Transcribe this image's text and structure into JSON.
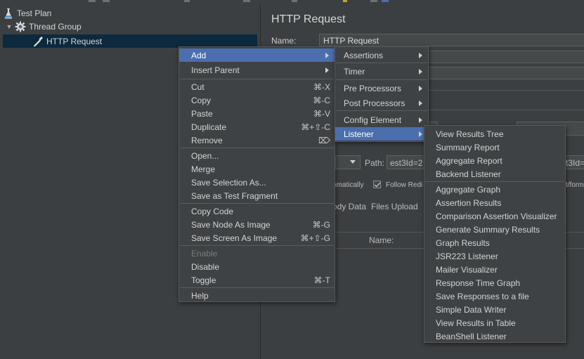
{
  "tree": {
    "items": [
      {
        "label": "Test Plan",
        "icon": "flask-icon"
      },
      {
        "label": "Thread Group",
        "icon": "gear-icon"
      },
      {
        "label": "HTTP Request",
        "icon": "pipette-icon"
      }
    ]
  },
  "editor": {
    "title": "HTTP Request",
    "name_label": "Name:",
    "name_value": "HTTP Request",
    "path_label": "Path:",
    "path_value": "est3Id=2",
    "path_right_value": "t3Id=",
    "auto_label": "omatically",
    "follow_label": "Follow Redi",
    "form_label": "t/form",
    "tab_body": "ody Data",
    "tab_files": "Files Upload",
    "table_name_header": "Name:"
  },
  "context_menu": {
    "items": [
      {
        "label": "Add",
        "shortcut": "",
        "submenu": true,
        "highlight": true
      },
      {
        "label": "Insert Parent",
        "shortcut": "",
        "submenu": true
      },
      {
        "label": "Cut",
        "shortcut": "⌘-X"
      },
      {
        "label": "Copy",
        "shortcut": "⌘-C"
      },
      {
        "label": "Paste",
        "shortcut": "⌘-V"
      },
      {
        "label": "Duplicate",
        "shortcut": "⌘+⇧-C"
      },
      {
        "label": "Remove",
        "shortcut": "⌦"
      },
      {
        "label": "Open...",
        "shortcut": ""
      },
      {
        "label": "Merge",
        "shortcut": ""
      },
      {
        "label": "Save Selection As...",
        "shortcut": ""
      },
      {
        "label": "Save as Test Fragment",
        "shortcut": ""
      },
      {
        "label": "Copy Code",
        "shortcut": ""
      },
      {
        "label": "Save Node As Image",
        "shortcut": "⌘-G"
      },
      {
        "label": "Save Screen As Image",
        "shortcut": "⌘+⇧-G"
      },
      {
        "label": "Enable",
        "shortcut": "",
        "disabled": true
      },
      {
        "label": "Disable",
        "shortcut": ""
      },
      {
        "label": "Toggle",
        "shortcut": "⌘-T"
      },
      {
        "label": "Help",
        "shortcut": ""
      }
    ]
  },
  "add_menu": {
    "items": [
      {
        "label": "Assertions"
      },
      {
        "label": "Timer"
      },
      {
        "label": "Pre Processors"
      },
      {
        "label": "Post Processors"
      },
      {
        "label": "Config Element"
      },
      {
        "label": "Listener",
        "highlight": true
      }
    ]
  },
  "listener_menu": {
    "items": [
      "View Results Tree",
      "Summary Report",
      "Aggregate Report",
      "Backend Listener",
      "Aggregate Graph",
      "Assertion Results",
      "Comparison Assertion Visualizer",
      "Generate Summary Results",
      "Graph Results",
      "JSR223 Listener",
      "Mailer Visualizer",
      "Response Time Graph",
      "Save Responses to a file",
      "Simple Data Writer",
      "View Results in Table",
      "BeanShell Listener"
    ]
  },
  "colors": {
    "background": "#3c3f41",
    "menu_background": "#3e4244",
    "highlight": "#4b6eaf",
    "selection": "#0d293e",
    "text": "#d4d4d4"
  }
}
